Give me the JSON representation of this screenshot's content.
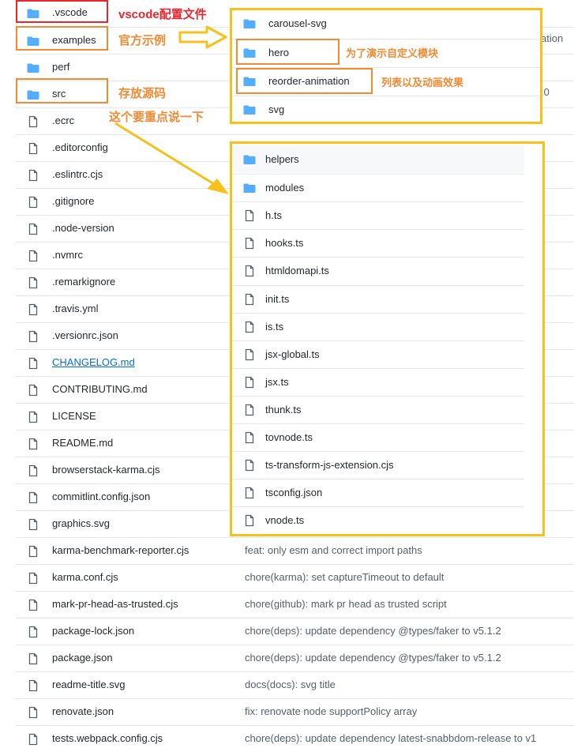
{
  "rows": [
    {
      "type": "folder",
      "name": ".vscode"
    },
    {
      "type": "folder",
      "name": "examples"
    },
    {
      "type": "folder",
      "name": "perf"
    },
    {
      "type": "folder",
      "name": "src"
    },
    {
      "type": "file",
      "name": ".ecrc"
    },
    {
      "type": "file",
      "name": ".editorconfig"
    },
    {
      "type": "file",
      "name": ".eslintrc.cjs"
    },
    {
      "type": "file",
      "name": ".gitignore"
    },
    {
      "type": "file",
      "name": ".node-version"
    },
    {
      "type": "file",
      "name": ".nvmrc"
    },
    {
      "type": "file",
      "name": ".remarkignore"
    },
    {
      "type": "file",
      "name": ".travis.yml"
    },
    {
      "type": "file",
      "name": ".versionrc.json"
    },
    {
      "type": "file",
      "name": "CHANGELOG.md",
      "link": true
    },
    {
      "type": "file",
      "name": "CONTRIBUTING.md"
    },
    {
      "type": "file",
      "name": "LICENSE"
    },
    {
      "type": "file",
      "name": "README.md"
    },
    {
      "type": "file",
      "name": "browserstack-karma.cjs"
    },
    {
      "type": "file",
      "name": "commitlint.config.json"
    },
    {
      "type": "file",
      "name": "graphics.svg"
    },
    {
      "type": "file",
      "name": "karma-benchmark-reporter.cjs",
      "message": "feat: only esm and correct import paths"
    },
    {
      "type": "file",
      "name": "karma.conf.cjs",
      "message": "chore(karma): set captureTimeout to default"
    },
    {
      "type": "file",
      "name": "mark-pr-head-as-trusted.cjs",
      "message": "chore(github): mark pr head as trusted script"
    },
    {
      "type": "file",
      "name": "package-lock.json",
      "message": "chore(deps): update dependency @types/faker to v5.1.2"
    },
    {
      "type": "file",
      "name": "package.json",
      "message": "chore(deps): update dependency @types/faker to v5.1.2"
    },
    {
      "type": "file",
      "name": "readme-title.svg",
      "message": "docs(docs): svg title"
    },
    {
      "type": "file",
      "name": "renovate.json",
      "message": "fix: renovate node supportPolicy array"
    },
    {
      "type": "file",
      "name": "tests.webpack.config.cjs",
      "message": "chore(deps): update dependency latest-snabbdom-release to v1"
    }
  ],
  "partial": {
    "examples_tail": "ation",
    "src_tail": ".0"
  },
  "annotations": {
    "vscode": "vscode配置文件",
    "examples": "官方示例",
    "src": "存放源码",
    "src_detail": "这个要重点说一下",
    "hero": "为了演示自定义模块",
    "reorder": "列表以及动画效果"
  },
  "examples_panel": [
    {
      "type": "folder",
      "name": "carousel-svg"
    },
    {
      "type": "folder",
      "name": "hero"
    },
    {
      "type": "folder",
      "name": "reorder-animation"
    },
    {
      "type": "folder",
      "name": "svg"
    }
  ],
  "src_panel": [
    {
      "type": "folder",
      "name": "helpers"
    },
    {
      "type": "folder",
      "name": "modules"
    },
    {
      "type": "file",
      "name": "h.ts"
    },
    {
      "type": "file",
      "name": "hooks.ts"
    },
    {
      "type": "file",
      "name": "htmldomapi.ts"
    },
    {
      "type": "file",
      "name": "init.ts"
    },
    {
      "type": "file",
      "name": "is.ts"
    },
    {
      "type": "file",
      "name": "jsx-global.ts"
    },
    {
      "type": "file",
      "name": "jsx.ts"
    },
    {
      "type": "file",
      "name": "thunk.ts"
    },
    {
      "type": "file",
      "name": "tovnode.ts"
    },
    {
      "type": "file",
      "name": "ts-transform-js-extension.cjs"
    },
    {
      "type": "file",
      "name": "tsconfig.json"
    },
    {
      "type": "file",
      "name": "vnode.ts"
    }
  ],
  "colors": {
    "folder": "#54aeff",
    "file_icon": "#57606a",
    "red": "#e8262d",
    "orange": "#f08a33",
    "yellow": "#f6c11a"
  },
  "icons": {
    "folder": "folder-icon",
    "file": "file-icon"
  }
}
